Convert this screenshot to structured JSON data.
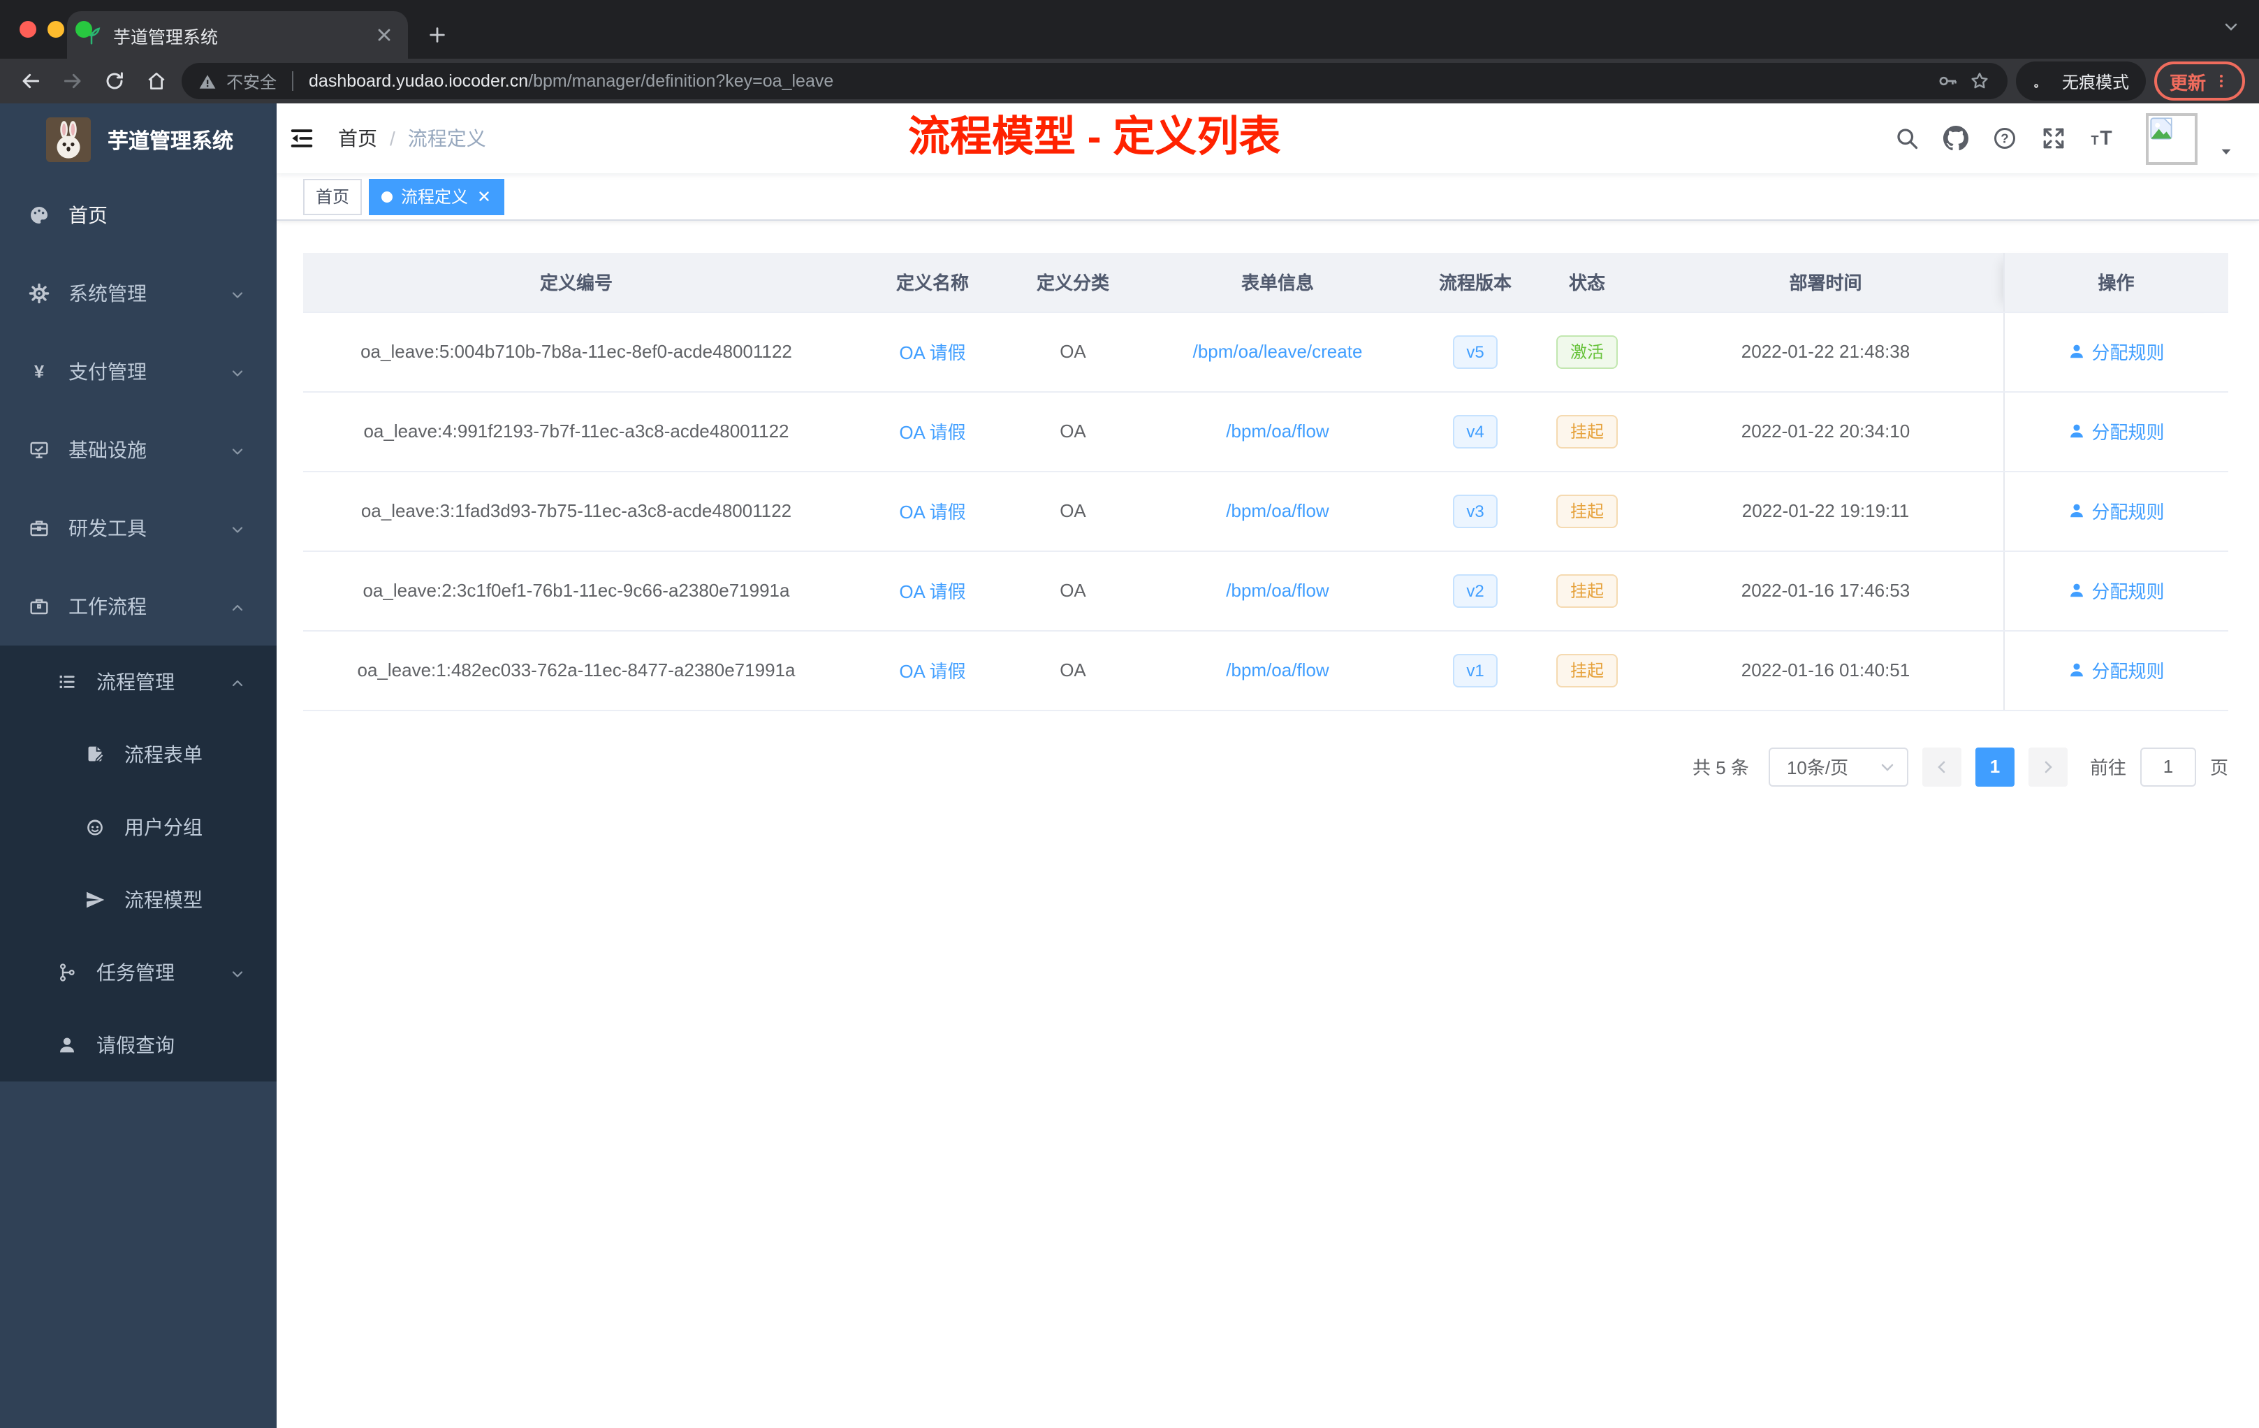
{
  "colors": {
    "accent": "#409eff",
    "overlay_title_color": "#ff2200",
    "status_active_color": "#67c23a",
    "status_suspended_color": "#e6a23c",
    "sidebar_bg": "#304156",
    "sidebar_submenu_bg": "#1f2d3d"
  },
  "browser": {
    "tab_title": "芋道管理系统",
    "tab_favicon": "leaf-icon",
    "security_label": "不安全",
    "url_host": "dashboard.yudao.iocoder.cn",
    "url_path": "/bpm/manager/definition?key=oa_leave",
    "incognito_label": "无痕模式",
    "update_label": "更新"
  },
  "sidebar": {
    "logo_title": "芋道管理系统",
    "items": [
      {
        "label": "首页",
        "icon": "dashboard",
        "level": 0,
        "arrow": null,
        "dark": false,
        "bright": true
      },
      {
        "label": "系统管理",
        "icon": "gear",
        "level": 0,
        "arrow": "down",
        "dark": false,
        "bright": false
      },
      {
        "label": "支付管理",
        "icon": "yen",
        "level": 0,
        "arrow": "down",
        "dark": false,
        "bright": false
      },
      {
        "label": "基础设施",
        "icon": "monitor",
        "level": 0,
        "arrow": "down",
        "dark": false,
        "bright": false
      },
      {
        "label": "研发工具",
        "icon": "toolbox",
        "level": 0,
        "arrow": "down",
        "dark": false,
        "bright": false
      },
      {
        "label": "工作流程",
        "icon": "briefcase",
        "level": 0,
        "arrow": "up",
        "dark": false,
        "bright": false
      },
      {
        "label": "流程管理",
        "icon": "list",
        "level": 1,
        "arrow": "up",
        "dark": true,
        "bright": false
      },
      {
        "label": "流程表单",
        "icon": "doc-edit",
        "level": 2,
        "arrow": null,
        "dark": true,
        "bright": false
      },
      {
        "label": "用户分组",
        "icon": "robot",
        "level": 2,
        "arrow": null,
        "dark": true,
        "bright": false
      },
      {
        "label": "流程模型",
        "icon": "paper-plane",
        "level": 2,
        "arrow": null,
        "dark": true,
        "bright": false
      },
      {
        "label": "任务管理",
        "icon": "tree",
        "level": 1,
        "arrow": "down",
        "dark": true,
        "bright": false
      },
      {
        "label": "请假查询",
        "icon": "user",
        "level": 1,
        "arrow": null,
        "dark": true,
        "bright": false
      }
    ]
  },
  "header": {
    "breadcrumb": {
      "home": "首页",
      "separator": "/",
      "current": "流程定义"
    },
    "overlay_title": "流程模型 - 定义列表",
    "actions": [
      {
        "icon": "search"
      },
      {
        "icon": "github"
      },
      {
        "icon": "question"
      },
      {
        "icon": "fullscreen"
      },
      {
        "icon": "text-size"
      }
    ]
  },
  "tags": [
    {
      "label": "首页",
      "active": false
    },
    {
      "label": "流程定义",
      "active": true
    }
  ],
  "table": {
    "columns": [
      "定义编号",
      "定义名称",
      "定义分类",
      "表单信息",
      "流程版本",
      "状态",
      "部署时间",
      "操作"
    ],
    "rows": [
      {
        "id": "oa_leave:5:004b710b-7b8a-11ec-8ef0-acde48001122",
        "name": "OA 请假",
        "category": "OA",
        "form": "/bpm/oa/leave/create",
        "version": "v5",
        "status": "激活",
        "status_type": "active",
        "time": "2022-01-22 21:48:38",
        "action": "分配规则"
      },
      {
        "id": "oa_leave:4:991f2193-7b7f-11ec-a3c8-acde48001122",
        "name": "OA 请假",
        "category": "OA",
        "form": "/bpm/oa/flow",
        "version": "v4",
        "status": "挂起",
        "status_type": "suspended",
        "time": "2022-01-22 20:34:10",
        "action": "分配规则"
      },
      {
        "id": "oa_leave:3:1fad3d93-7b75-11ec-a3c8-acde48001122",
        "name": "OA 请假",
        "category": "OA",
        "form": "/bpm/oa/flow",
        "version": "v3",
        "status": "挂起",
        "status_type": "suspended",
        "time": "2022-01-22 19:19:11",
        "action": "分配规则"
      },
      {
        "id": "oa_leave:2:3c1f0ef1-76b1-11ec-9c66-a2380e71991a",
        "name": "OA 请假",
        "category": "OA",
        "form": "/bpm/oa/flow",
        "version": "v2",
        "status": "挂起",
        "status_type": "suspended",
        "time": "2022-01-16 17:46:53",
        "action": "分配规则"
      },
      {
        "id": "oa_leave:1:482ec033-762a-11ec-8477-a2380e71991a",
        "name": "OA 请假",
        "category": "OA",
        "form": "/bpm/oa/flow",
        "version": "v1",
        "status": "挂起",
        "status_type": "suspended",
        "time": "2022-01-16 01:40:51",
        "action": "分配规则"
      }
    ]
  },
  "pagination": {
    "total_label": "共 5 条",
    "page_size": "10条/页",
    "current_page": "1",
    "goto_label": "前往",
    "goto_value": "1",
    "page_unit": "页"
  }
}
